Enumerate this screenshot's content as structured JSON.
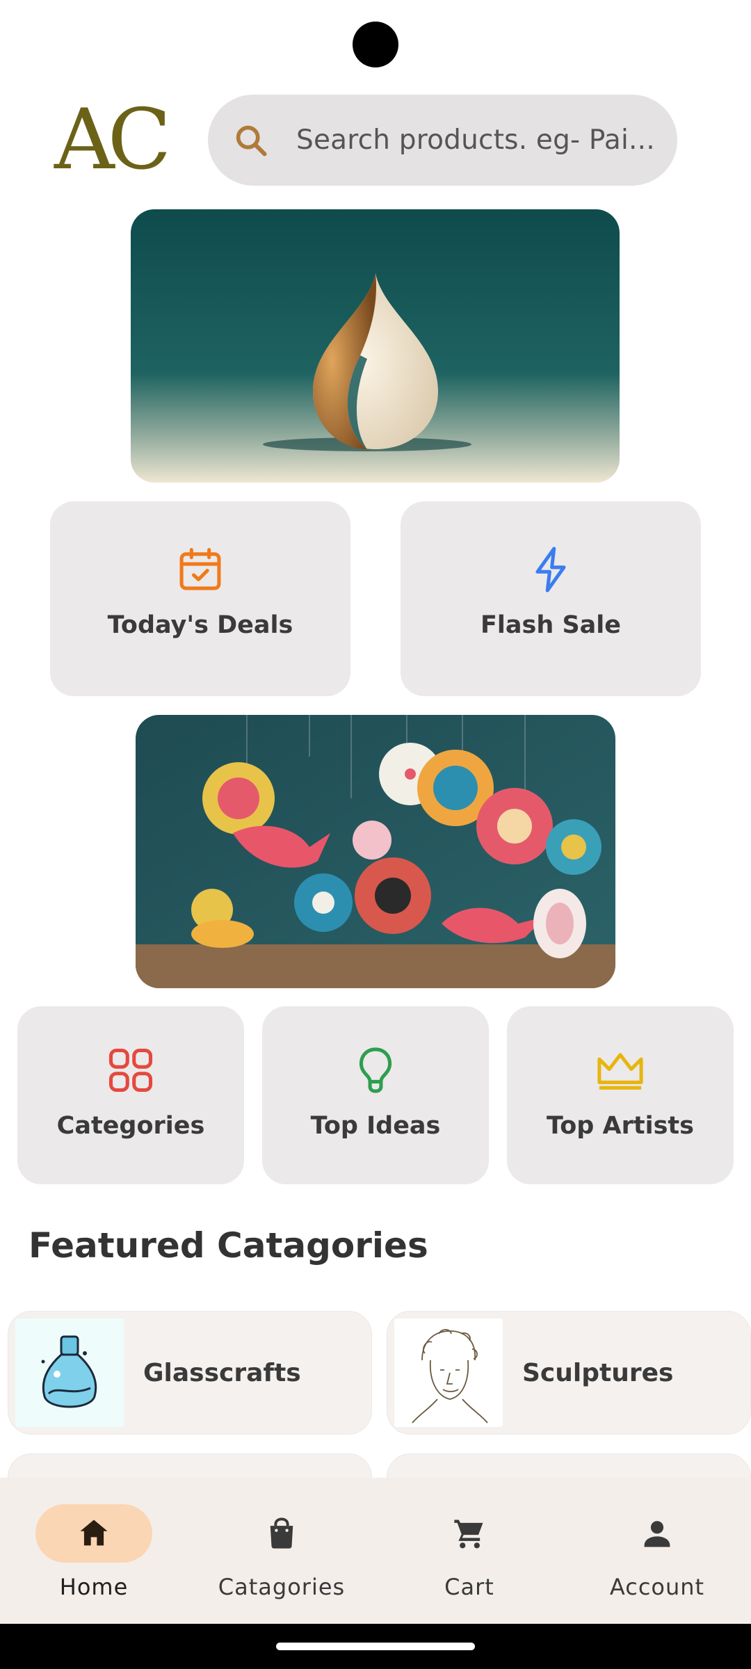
{
  "header": {
    "logo_text": "AC",
    "search_placeholder": "Search products. eg- Pai..."
  },
  "quick_actions": [
    {
      "label": "Today's Deals",
      "icon": "calendar-check-icon",
      "color": "#f07a1a"
    },
    {
      "label": "Flash Sale",
      "icon": "lightning-icon",
      "color": "#3b7df0"
    }
  ],
  "shortcuts": [
    {
      "label": "Categories",
      "icon": "grid-icon",
      "color": "#e5483d"
    },
    {
      "label": "Top Ideas",
      "icon": "lightbulb-icon",
      "color": "#2e9e4f"
    },
    {
      "label": "Top Artists",
      "icon": "crown-icon",
      "color": "#e8b50f"
    }
  ],
  "featured": {
    "title": "Featured Catagories",
    "items": [
      {
        "label": "Glasscrafts",
        "icon": "glass-bottle-icon"
      },
      {
        "label": "Sculptures",
        "icon": "sculpture-sketch-icon"
      }
    ]
  },
  "nav": {
    "items": [
      {
        "label": "Home",
        "icon": "home-icon",
        "active": true
      },
      {
        "label": "Catagories",
        "icon": "shopping-bag-icon",
        "active": false
      },
      {
        "label": "Cart",
        "icon": "cart-icon",
        "active": false
      },
      {
        "label": "Account",
        "icon": "person-icon",
        "active": false
      }
    ]
  }
}
